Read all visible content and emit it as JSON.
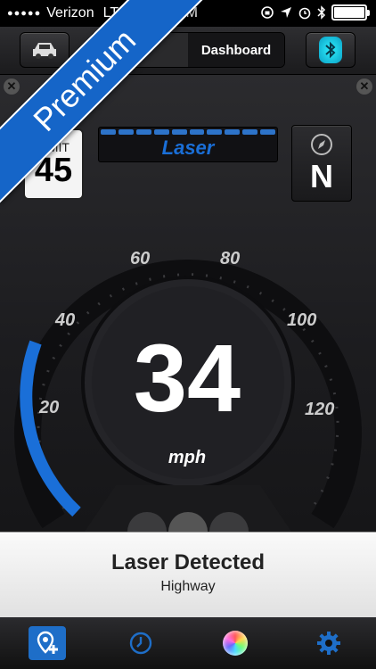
{
  "status_bar": {
    "signal": "●●●●●",
    "carrier": "Verizon",
    "network": "LTE",
    "time": "AM",
    "battery_level": 1.0
  },
  "toolbar": {
    "segments": [
      "",
      "Dashboard"
    ],
    "active_segment": "Dashboard"
  },
  "ribbon": {
    "text": "Premium"
  },
  "speed_limit": {
    "label": "LIMIT",
    "value": "45"
  },
  "alert_display": {
    "text": "Laser",
    "bar_color": "#2d73c9"
  },
  "compass": {
    "direction": "N"
  },
  "gauge": {
    "speed": "34",
    "unit": "mph",
    "ticks": [
      "20",
      "40",
      "60",
      "80",
      "100",
      "120"
    ],
    "accent_color": "#1a6fd8"
  },
  "notification": {
    "title": "Laser Detected",
    "subtitle": "Highway"
  },
  "tabbar": {
    "icons": [
      "add-location-icon",
      "clock-icon",
      "color-wheel-icon",
      "settings-icon"
    ],
    "accent": "#1e6ec8"
  }
}
